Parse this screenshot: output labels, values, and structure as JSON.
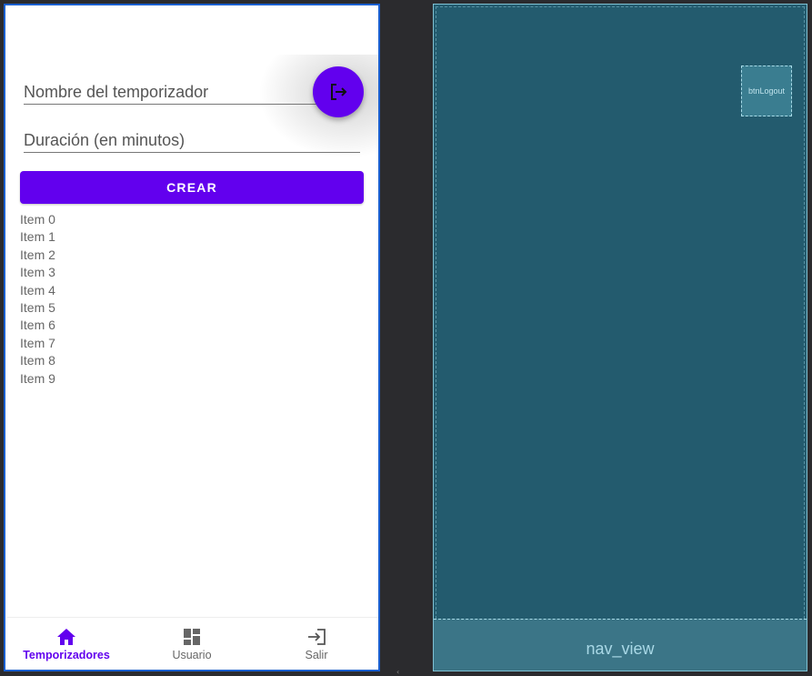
{
  "form": {
    "name_placeholder": "Nombre del temporizador",
    "duration_placeholder": "Duración (en minutos)",
    "create_label": "CREAR"
  },
  "list": {
    "items": [
      "Item 0",
      "Item 1",
      "Item 2",
      "Item 3",
      "Item 4",
      "Item 5",
      "Item 6",
      "Item 7",
      "Item 8",
      "Item 9"
    ]
  },
  "bottom_nav": {
    "items": [
      {
        "label": "Temporizadores",
        "icon": "home-icon",
        "active": true
      },
      {
        "label": "Usuario",
        "icon": "dashboard-icon",
        "active": false
      },
      {
        "label": "Salir",
        "icon": "login-icon",
        "active": false
      }
    ]
  },
  "blueprint": {
    "logout_id": "btnLogout",
    "nav_id": "nav_view"
  },
  "colors": {
    "accent": "#6200ee",
    "blueprint_bg": "#235b6e"
  }
}
